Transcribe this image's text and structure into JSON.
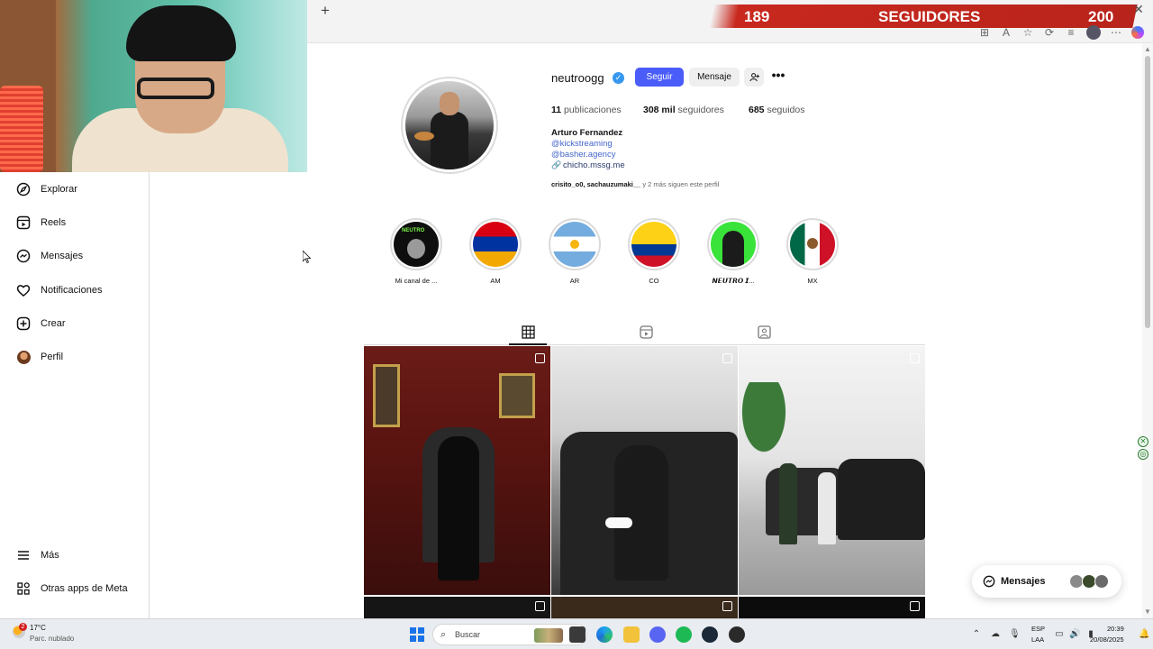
{
  "overlay": {
    "followers_current": "189",
    "followers_label": "SEGUIDORES",
    "followers_goal": "200"
  },
  "sidebar": {
    "items": [
      {
        "label": "Explorar",
        "icon": "compass-icon"
      },
      {
        "label": "Reels",
        "icon": "reels-icon"
      },
      {
        "label": "Mensajes",
        "icon": "messenger-icon"
      },
      {
        "label": "Notificaciones",
        "icon": "heart-icon"
      },
      {
        "label": "Crear",
        "icon": "plus-square-icon"
      },
      {
        "label": "Perfil",
        "icon": "profile-avatar"
      }
    ],
    "bottom": [
      {
        "label": "Más",
        "icon": "menu-icon"
      },
      {
        "label": "Otras apps de Meta",
        "icon": "apps-icon"
      }
    ]
  },
  "profile": {
    "username": "neutroogg",
    "follow_label": "Seguir",
    "message_label": "Mensaje",
    "posts_count": "11",
    "posts_label": "publicaciones",
    "followers_count": "308 mil",
    "followers_label": "seguidores",
    "following_count": "685",
    "following_label": "seguidos",
    "full_name": "Arturo Fernandez",
    "bio_line_1": "@kickstreaming",
    "bio_line_2": "@basher.agency",
    "link": "chicho.mssg.me",
    "followed_by_names": "crisito_o0, sachauzumaki__",
    "followed_by_rest": "y 2 más siguen este perfil"
  },
  "highlights": [
    {
      "label": "Mi canal de ..."
    },
    {
      "label": "AM"
    },
    {
      "label": "AR"
    },
    {
      "label": "CO"
    },
    {
      "label": "𝙉𝙀𝙐𝙏𝙍𝙊 𝙄..."
    },
    {
      "label": "MX"
    }
  ],
  "messages_pill": {
    "label": "Mensajes"
  },
  "taskbar": {
    "weather_badge": "2",
    "temperature": "17°C",
    "weather_desc": "Parc. nublado",
    "search_label": "Buscar",
    "lang_1": "ESP",
    "lang_2": "LAA",
    "time": "20:39",
    "date": "20/08/2025"
  }
}
